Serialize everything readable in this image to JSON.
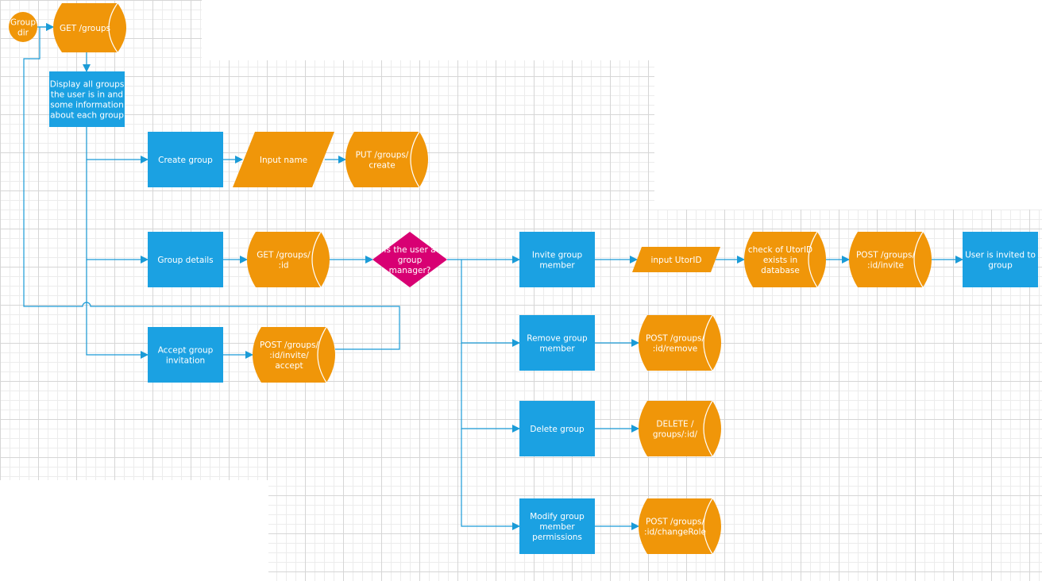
{
  "colors": {
    "process": "#1ba1e2",
    "api": "#f09609",
    "decision": "#d80073",
    "connector": "#1a9bd7",
    "text": "#ffffff"
  },
  "nodes": {
    "group_dir": {
      "lines": [
        "Group",
        "dir"
      ],
      "shape": "circle"
    },
    "get_groups": {
      "lines": [
        "GET /groups"
      ],
      "shape": "cylinder"
    },
    "display_groups": {
      "lines": [
        "Display all groups",
        "the user is in and",
        "some information",
        "about each group"
      ],
      "shape": "rect"
    },
    "create_group": {
      "lines": [
        "Create group"
      ],
      "shape": "rect"
    },
    "input_name": {
      "lines": [
        "Input name"
      ],
      "shape": "parallelogram"
    },
    "put_create": {
      "lines": [
        "PUT /groups/",
        "create"
      ],
      "shape": "cylinder"
    },
    "group_details": {
      "lines": [
        "Group details"
      ],
      "shape": "rect"
    },
    "get_group_id": {
      "lines": [
        "GET /groups/",
        ":id"
      ],
      "shape": "cylinder"
    },
    "is_manager": {
      "lines": [
        "Is the user a",
        "group",
        "manager?"
      ],
      "shape": "diamond"
    },
    "accept_invitation": {
      "lines": [
        "Accept group",
        "invitation"
      ],
      "shape": "rect"
    },
    "post_accept": {
      "lines": [
        "POST /groups/",
        ":id/invite/",
        "accept"
      ],
      "shape": "cylinder"
    },
    "invite_member": {
      "lines": [
        "Invite group",
        "member"
      ],
      "shape": "rect"
    },
    "input_utorid": {
      "lines": [
        "input UtorID"
      ],
      "shape": "parallelogram"
    },
    "check_utorid": {
      "lines": [
        "check of UtorID",
        "exists in",
        "database"
      ],
      "shape": "cylinder"
    },
    "post_invite": {
      "lines": [
        "POST /groups/",
        ":id/invite"
      ],
      "shape": "cylinder"
    },
    "user_invited": {
      "lines": [
        "User is invited to",
        "group"
      ],
      "shape": "rect"
    },
    "remove_member": {
      "lines": [
        "Remove group",
        "member"
      ],
      "shape": "rect"
    },
    "post_remove": {
      "lines": [
        "POST /groups/",
        ":id/remove"
      ],
      "shape": "cylinder"
    },
    "delete_group": {
      "lines": [
        "Delete group"
      ],
      "shape": "rect"
    },
    "delete_endpoint": {
      "lines": [
        "DELETE /",
        "groups/:id/"
      ],
      "shape": "cylinder"
    },
    "modify_permissions": {
      "lines": [
        "Modify group",
        "member",
        "permissions"
      ],
      "shape": "rect"
    },
    "post_change_role": {
      "lines": [
        "POST /groups/",
        ":id/changeRole"
      ],
      "shape": "cylinder"
    }
  },
  "edges": [
    {
      "from": "group_dir",
      "to": "get_groups"
    },
    {
      "from": "get_groups",
      "to": "display_groups"
    },
    {
      "from": "display_groups",
      "to": "create_group"
    },
    {
      "from": "display_groups",
      "to": "group_details"
    },
    {
      "from": "display_groups",
      "to": "accept_invitation"
    },
    {
      "from": "create_group",
      "to": "input_name"
    },
    {
      "from": "input_name",
      "to": "put_create"
    },
    {
      "from": "group_details",
      "to": "get_group_id"
    },
    {
      "from": "get_group_id",
      "to": "is_manager"
    },
    {
      "from": "accept_invitation",
      "to": "post_accept"
    },
    {
      "from": "post_accept",
      "to": "get_groups"
    },
    {
      "from": "is_manager",
      "to": "invite_member"
    },
    {
      "from": "is_manager",
      "to": "remove_member"
    },
    {
      "from": "is_manager",
      "to": "delete_group"
    },
    {
      "from": "is_manager",
      "to": "modify_permissions"
    },
    {
      "from": "invite_member",
      "to": "input_utorid"
    },
    {
      "from": "input_utorid",
      "to": "check_utorid"
    },
    {
      "from": "check_utorid",
      "to": "post_invite"
    },
    {
      "from": "post_invite",
      "to": "user_invited"
    },
    {
      "from": "remove_member",
      "to": "post_remove"
    },
    {
      "from": "delete_group",
      "to": "delete_endpoint"
    },
    {
      "from": "modify_permissions",
      "to": "post_change_role"
    }
  ]
}
